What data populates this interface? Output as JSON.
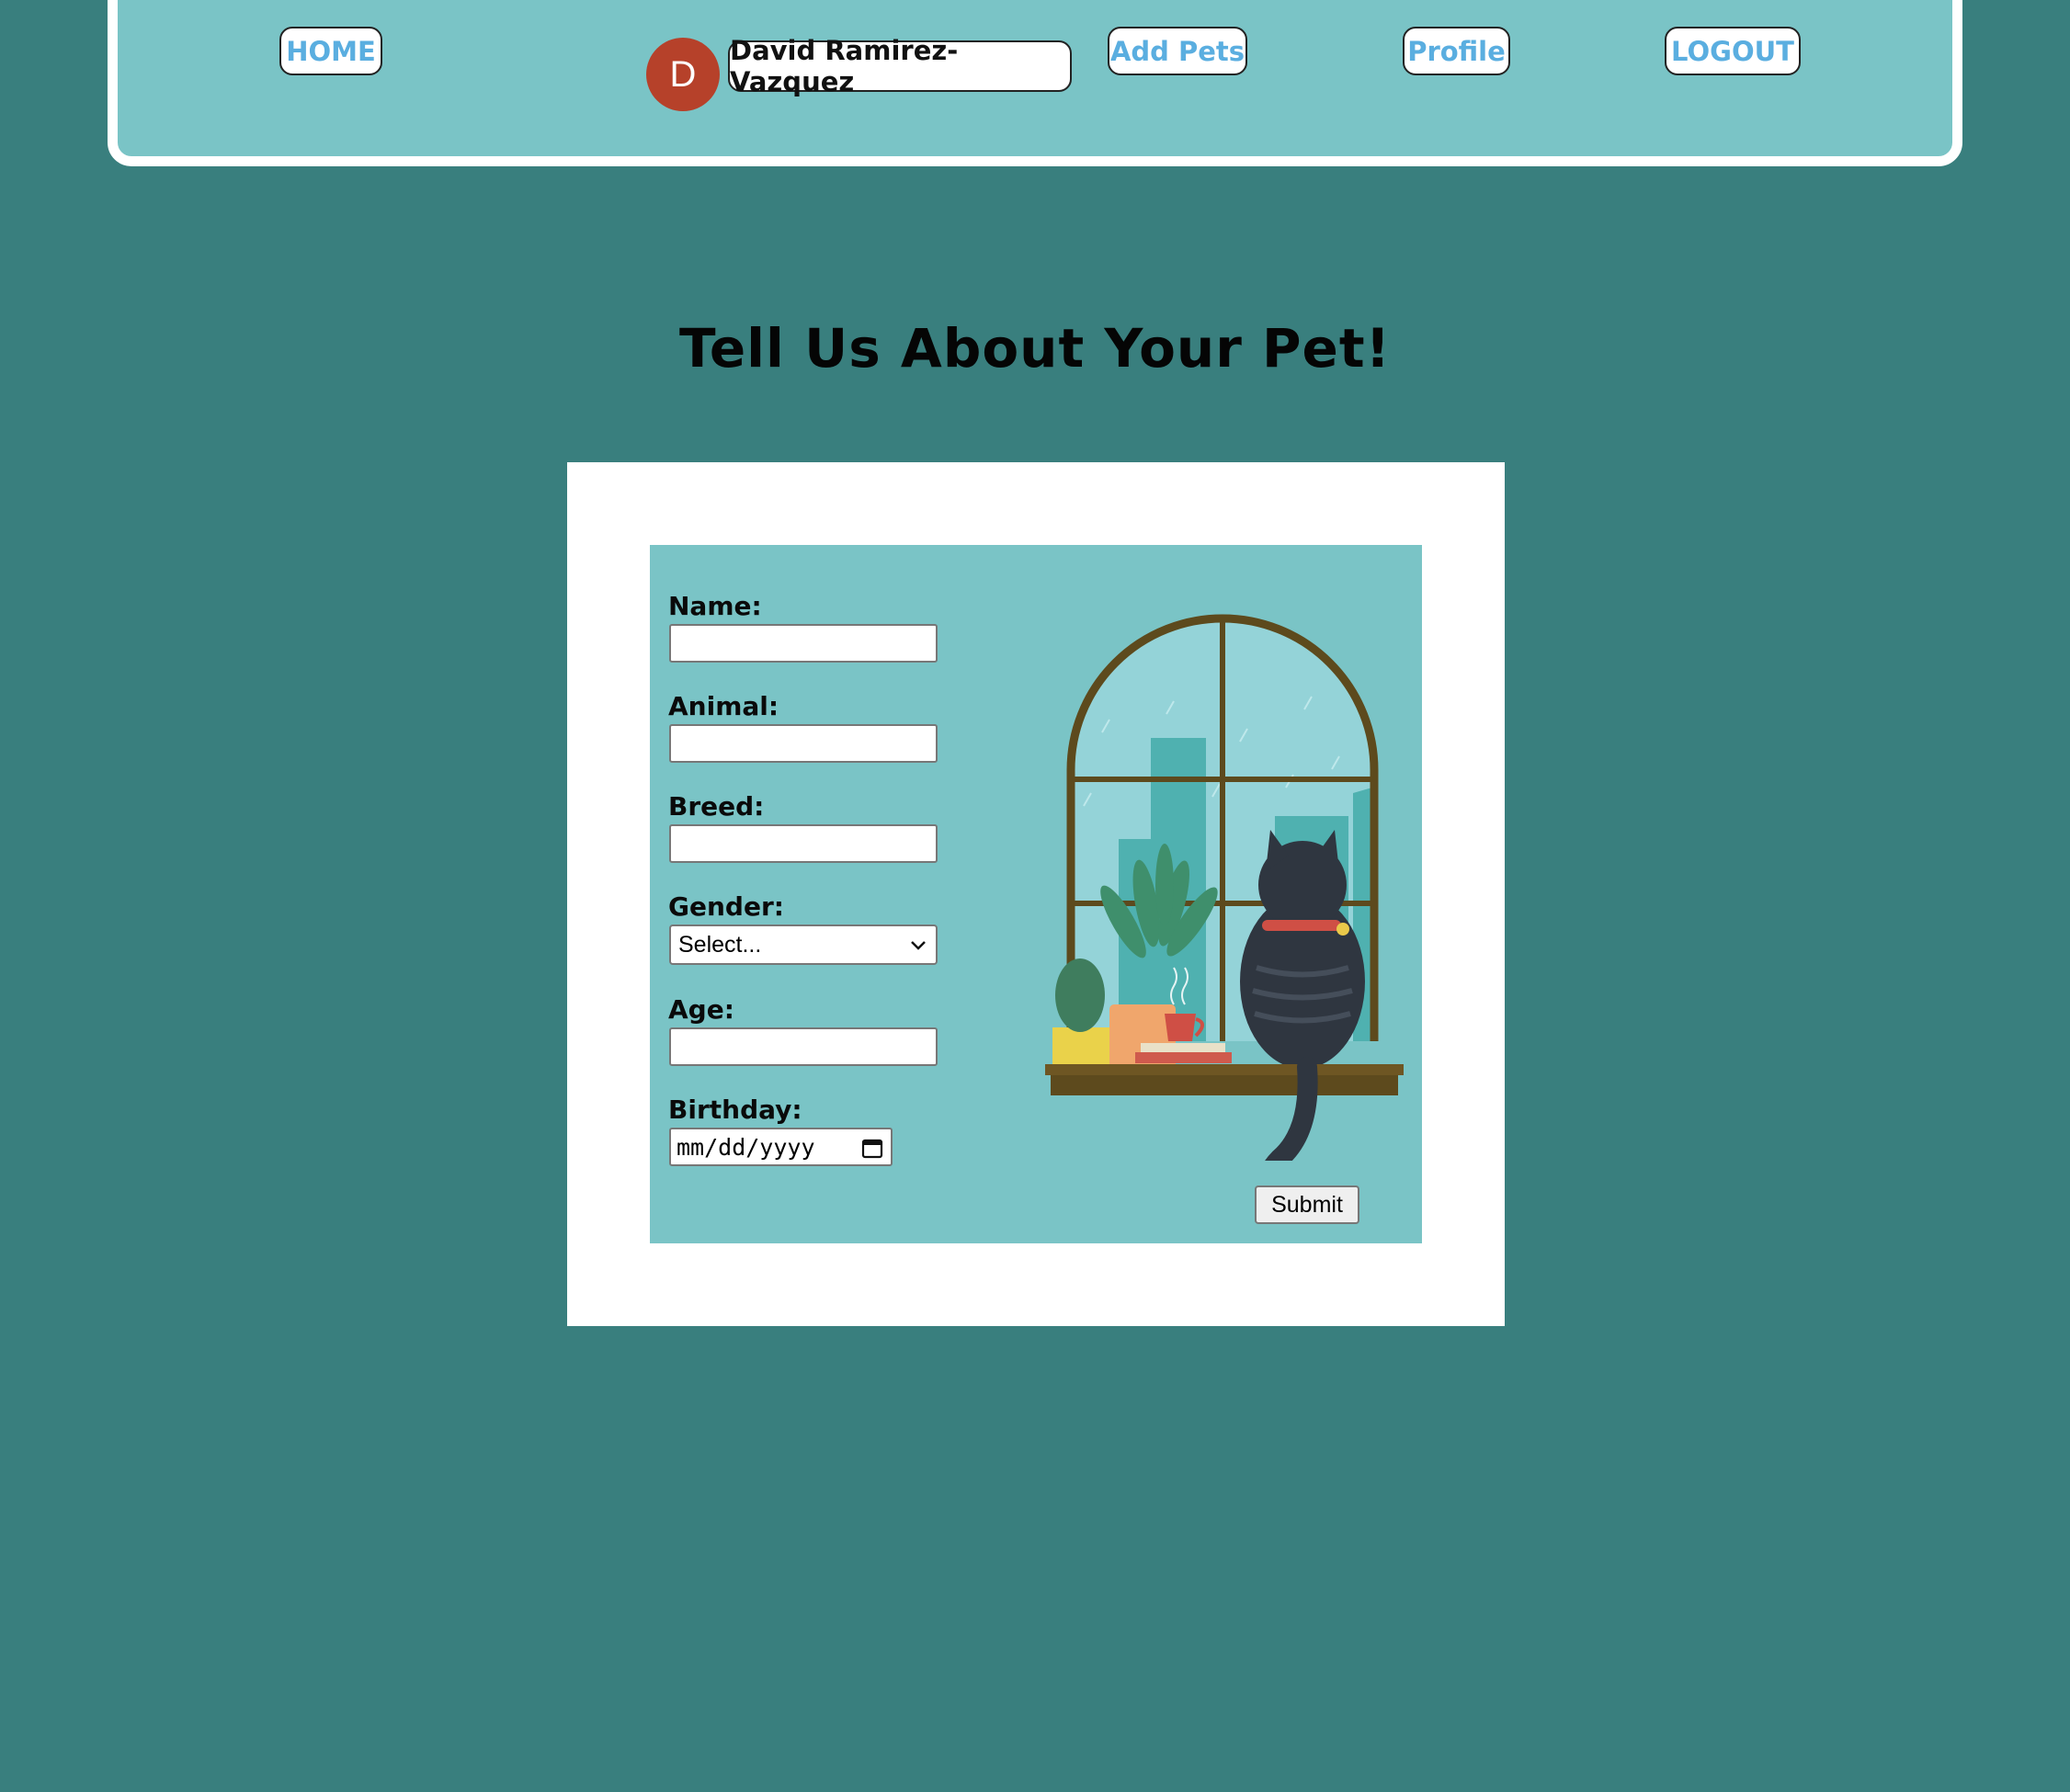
{
  "nav": {
    "home": "HOME",
    "avatar_initial": "D",
    "username": "David Ramirez-Vazquez",
    "add_pets": "Add Pets",
    "profile": "Profile",
    "logout": "LOGOUT"
  },
  "page": {
    "title": "Tell Us About Your Pet!"
  },
  "form": {
    "name_label": "Name:",
    "animal_label": "Animal:",
    "breed_label": "Breed:",
    "gender_label": "Gender:",
    "gender_value": "Select...",
    "age_label": "Age:",
    "birthday_label": "Birthday:",
    "birthday_placeholder": "mm/dd/yyyy",
    "submit": "Submit"
  },
  "colors": {
    "background": "#397f7e",
    "panel": "#7ac4c6",
    "nav_link": "#5aaee0",
    "avatar": "#b6412a"
  },
  "icons": {
    "select_arrow": "chevron-down-icon",
    "date_picker": "calendar-icon"
  }
}
